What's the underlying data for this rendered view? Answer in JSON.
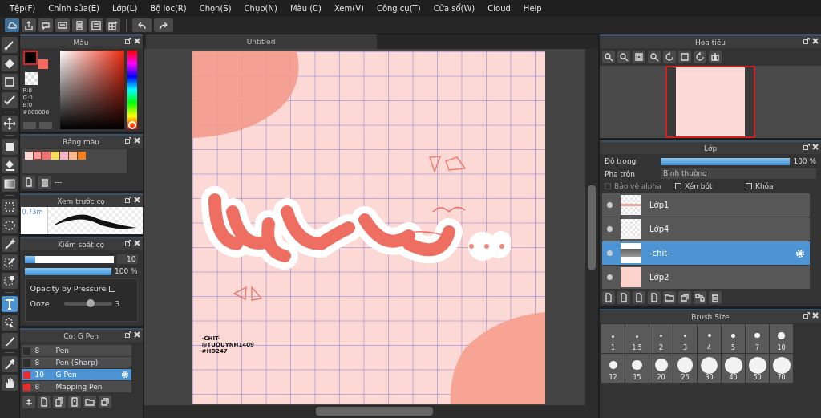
{
  "menu": [
    "Tệp(F)",
    "Chỉnh sửa(E)",
    "Lớp(L)",
    "Bộ lọc(R)",
    "Chọn(S)",
    "Chụp(N)",
    "Màu (C)",
    "Xem(V)",
    "Công cụ(T)",
    "Cửa sổ(W)",
    "Cloud",
    "Help"
  ],
  "tools": [
    {
      "kind": "brush",
      "selected": false
    },
    {
      "kind": "eraser",
      "selected": false
    },
    {
      "kind": "rect",
      "selected": false
    },
    {
      "kind": "dotline",
      "selected": false
    },
    {
      "kind": "move",
      "selected": false
    },
    {
      "kind": "fill",
      "selected": false
    },
    {
      "kind": "bucket",
      "selected": false
    },
    {
      "kind": "gradient",
      "selected": false
    },
    {
      "kind": "select",
      "selected": false
    },
    {
      "kind": "lasso",
      "selected": false
    },
    {
      "kind": "wand",
      "selected": false
    },
    {
      "kind": "selectpen",
      "selected": false
    },
    {
      "kind": "selecterase",
      "selected": false
    },
    {
      "kind": "text",
      "selected": true
    },
    {
      "kind": "operation",
      "selected": false
    },
    {
      "kind": "knife",
      "selected": false
    },
    {
      "kind": "dropper",
      "selected": false
    },
    {
      "kind": "hand",
      "selected": false
    }
  ],
  "color_panel": {
    "title": "Màu",
    "readouts": [
      "R:0",
      "G:0",
      "B:0"
    ],
    "hex": "#000000"
  },
  "palette_panel": {
    "title": "Bảng màu",
    "label": "---",
    "swatches": [
      {
        "color": "#fdd7d2",
        "selected": false
      },
      {
        "color": "#f7a0a0",
        "selected": true
      },
      {
        "color": "#f2706a",
        "selected": false
      },
      {
        "color": "#f7dc5a",
        "selected": false
      },
      {
        "color": "#f9b3c6",
        "selected": false
      },
      {
        "color": "#fbb98a",
        "selected": false
      },
      {
        "color": "#f97f1a",
        "selected": false
      }
    ]
  },
  "brush_preview": {
    "title": "Xem trước cọ",
    "size": "0.73m"
  },
  "brush_control": {
    "title": "Kiểm soát cọ",
    "size": {
      "level": 0.12,
      "value": "10"
    },
    "opacity": {
      "level": 1,
      "reading": "100 %"
    },
    "options": [
      {
        "kind": "checkbox",
        "label": "Opacity by Pressure",
        "checked": false
      },
      {
        "kind": "slider",
        "label": "Ooze",
        "level": 0.55,
        "value": "3"
      }
    ]
  },
  "brush_list": {
    "title": "Cọ: G Pen",
    "items": [
      {
        "size": "8",
        "name": "Pen",
        "color": "#2e2e2e",
        "selected": false
      },
      {
        "size": "8",
        "name": "Pen (Sharp)",
        "color": "#2e2e2e",
        "selected": false
      },
      {
        "size": "10",
        "name": "G Pen",
        "color": "#e82c2c",
        "selected": true
      },
      {
        "size": "8",
        "name": "Mapping Pen",
        "color": "#e82c2c",
        "selected": false
      }
    ]
  },
  "document": {
    "tab": "Untitled",
    "credits": [
      "-CHIT-",
      "@TUQUYNH1409",
      "#HD247"
    ]
  },
  "navigator": {
    "title": "Hoa tiêu"
  },
  "layers": {
    "title": "Lớp",
    "opacity_label": "Độ trong",
    "opacity": {
      "level": 1,
      "reading": "100 %"
    },
    "blend_label": "Pha trộn",
    "blend": "Bình thường",
    "options": [
      {
        "label": "Bảo vệ alpha",
        "checked": false,
        "disabled": true
      },
      {
        "label": "Xén bớt",
        "checked": false,
        "disabled": false
      },
      {
        "label": "Khóa",
        "checked": false,
        "disabled": false
      }
    ],
    "items": [
      {
        "name": "Lớp1",
        "kind": "sketch",
        "selected": false
      },
      {
        "name": "Lớp4",
        "kind": "blank",
        "selected": false
      },
      {
        "name": "-chit-",
        "kind": "text",
        "selected": true
      },
      {
        "name": "Lớp2",
        "kind": "pink",
        "selected": false
      }
    ]
  },
  "brush_size": {
    "title": "Brush Size",
    "sizes": [
      "1",
      "1.5",
      "2",
      "3",
      "4",
      "5",
      "7",
      "10",
      "12",
      "15",
      "20",
      "25",
      "30",
      "40",
      "50",
      "70"
    ]
  }
}
